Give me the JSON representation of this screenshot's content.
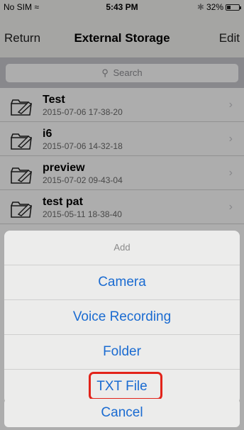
{
  "status": {
    "carrier": "No SIM",
    "time": "5:43 PM",
    "battery": "32%",
    "battery_fraction": 0.32
  },
  "nav": {
    "left": "Return",
    "title": "External Storage",
    "right": "Edit"
  },
  "search": {
    "placeholder": "Search"
  },
  "files": [
    {
      "name": "Test",
      "date": "2015-07-06 17-38-20"
    },
    {
      "name": "i6",
      "date": "2015-07-06 14-32-18"
    },
    {
      "name": "preview",
      "date": "2015-07-02 09-43-04"
    },
    {
      "name": "test pat",
      "date": "2015-05-11 18-38-40"
    }
  ],
  "sheet": {
    "title": "Add",
    "options": [
      "Camera",
      "Voice Recording",
      "Folder",
      "TXT File"
    ],
    "highlighted_option": "TXT File",
    "cancel": "Cancel"
  },
  "colors": {
    "accent": "#1a6bd1",
    "highlight": "#e2231a"
  },
  "icons": {
    "file_row": "folder-edit-icon",
    "row_arrow": "chevron-right-icon",
    "search": "search-icon",
    "wifi": "wifi-icon",
    "bluetooth": "bluetooth-icon",
    "battery": "battery-icon"
  }
}
